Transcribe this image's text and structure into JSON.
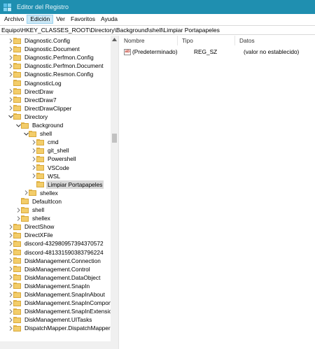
{
  "window": {
    "title": "Editor del Registro",
    "icon": "registry-editor-icon"
  },
  "menu": [
    {
      "label": "Archivo"
    },
    {
      "label": "Edición"
    },
    {
      "label": "Ver"
    },
    {
      "label": "Favoritos"
    },
    {
      "label": "Ayuda"
    }
  ],
  "address": "Equipo\\HKEY_CLASSES_ROOT\\Directory\\Background\\shell\\Limpiar Portapapeles",
  "tree": [
    {
      "label": "Diagnostic.Config",
      "expander": "collapsed"
    },
    {
      "label": "Diagnostic.Document",
      "expander": "collapsed"
    },
    {
      "label": "Diagnostic.Perfmon.Config",
      "expander": "collapsed"
    },
    {
      "label": "Diagnostic.Perfmon.Document",
      "expander": "collapsed"
    },
    {
      "label": "Diagnostic.Resmon.Config",
      "expander": "collapsed"
    },
    {
      "label": "DiagnosticLog",
      "expander": "none"
    },
    {
      "label": "DirectDraw",
      "expander": "collapsed"
    },
    {
      "label": "DirectDraw7",
      "expander": "collapsed"
    },
    {
      "label": "DirectDrawClipper",
      "expander": "collapsed"
    },
    {
      "label": "Directory",
      "expander": "expanded"
    },
    {
      "label": "Background",
      "expander": "expanded"
    },
    {
      "label": "shell",
      "expander": "expanded"
    },
    {
      "label": "cmd",
      "expander": "collapsed"
    },
    {
      "label": "git_shell",
      "expander": "collapsed"
    },
    {
      "label": "Powershell",
      "expander": "collapsed"
    },
    {
      "label": "VSCode",
      "expander": "collapsed"
    },
    {
      "label": "WSL",
      "expander": "collapsed"
    },
    {
      "label": "Limpiar Portapapeles",
      "expander": "none",
      "selected": true
    },
    {
      "label": "shellex",
      "expander": "collapsed"
    },
    {
      "label": "DefaultIcon",
      "expander": "none"
    },
    {
      "label": "shell",
      "expander": "collapsed"
    },
    {
      "label": "shellex",
      "expander": "collapsed"
    },
    {
      "label": "DirectShow",
      "expander": "collapsed"
    },
    {
      "label": "DirectXFile",
      "expander": "collapsed"
    },
    {
      "label": "discord-432980957394370572",
      "expander": "collapsed"
    },
    {
      "label": "discord-481331590383796224",
      "expander": "collapsed"
    },
    {
      "label": "DiskManagement.Connection",
      "expander": "collapsed"
    },
    {
      "label": "DiskManagement.Control",
      "expander": "collapsed"
    },
    {
      "label": "DiskManagement.DataObject",
      "expander": "collapsed"
    },
    {
      "label": "DiskManagement.SnapIn",
      "expander": "collapsed"
    },
    {
      "label": "DiskManagement.SnapInAbout",
      "expander": "collapsed"
    },
    {
      "label": "DiskManagement.SnapInCompone",
      "expander": "collapsed"
    },
    {
      "label": "DiskManagement.SnapInExtension",
      "expander": "collapsed"
    },
    {
      "label": "DiskManagement.UITasks",
      "expander": "collapsed"
    },
    {
      "label": "DispatchMapper.DispatchMapper",
      "expander": "collapsed"
    }
  ],
  "list": {
    "columns": [
      "Nombre",
      "Tipo",
      "Datos"
    ],
    "rows": [
      {
        "icon": "string-value-icon",
        "icon_text": "ab",
        "name": "(Predeterminado)",
        "type": "REG_SZ",
        "data": "(valor no establecido)"
      }
    ]
  },
  "colors": {
    "titlebar": "#1f8fb0",
    "folder": "#f3cd6a",
    "selection": "#d9d9d9"
  }
}
